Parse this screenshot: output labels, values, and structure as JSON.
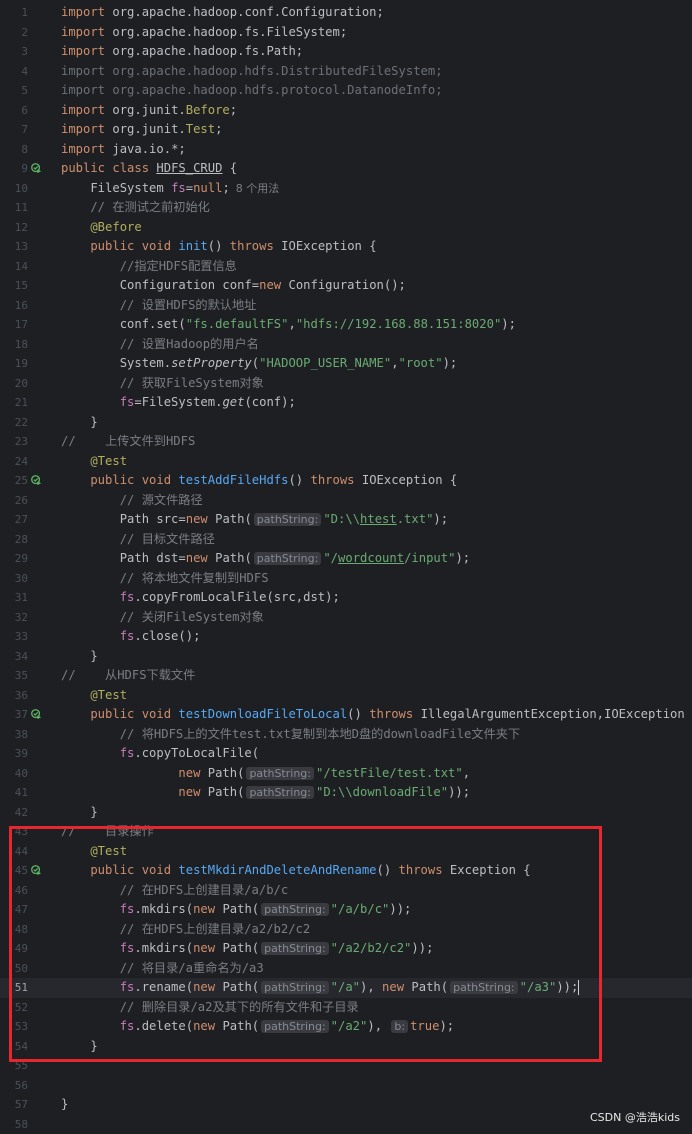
{
  "lines": [
    {
      "n": "1",
      "tokens": [
        [
          "kw",
          "import "
        ],
        [
          "",
          "org.apache.hadoop.conf.Configuration;"
        ]
      ]
    },
    {
      "n": "2",
      "tokens": [
        [
          "kw",
          "import "
        ],
        [
          "",
          "org.apache.hadoop.fs.FileSystem;"
        ]
      ]
    },
    {
      "n": "3",
      "tokens": [
        [
          "kw",
          "import "
        ],
        [
          "",
          "org.apache.hadoop.fs.Path;"
        ]
      ]
    },
    {
      "n": "4",
      "tokens": [
        [
          "dim",
          "import org.apache.hadoop.hdfs.DistributedFileSystem;"
        ]
      ]
    },
    {
      "n": "5",
      "tokens": [
        [
          "dim",
          "import org.apache.hadoop.hdfs.protocol.DatanodeInfo;"
        ]
      ]
    },
    {
      "n": "6",
      "tokens": [
        [
          "kw",
          "import "
        ],
        [
          "",
          "org.junit."
        ],
        [
          "ann",
          "Before"
        ],
        [
          "",
          ";"
        ]
      ]
    },
    {
      "n": "7",
      "tokens": [
        [
          "kw",
          "import "
        ],
        [
          "",
          "org.junit."
        ],
        [
          "ann",
          "Test"
        ],
        [
          "",
          ";"
        ]
      ]
    },
    {
      "n": "8",
      "tokens": [
        [
          "kw",
          "import "
        ],
        [
          "",
          "java.io.*;"
        ]
      ]
    },
    {
      "n": "9",
      "icon": true,
      "tokens": [
        [
          "kw",
          "public class "
        ],
        [
          "cls",
          "HDFS_CRUD"
        ],
        [
          "",
          " {"
        ]
      ]
    },
    {
      "n": "10",
      "tokens": [
        [
          "",
          "    FileSystem "
        ],
        [
          "fld",
          "fs"
        ],
        [
          "",
          "="
        ],
        [
          "kw",
          "null"
        ],
        [
          "",
          ";"
        ],
        [
          "usage",
          "8 个用法"
        ]
      ]
    },
    {
      "n": "11",
      "tokens": [
        [
          "cmt",
          "    // 在测试之前初始化"
        ]
      ]
    },
    {
      "n": "12",
      "tokens": [
        [
          "ann",
          "    @Before"
        ]
      ]
    },
    {
      "n": "13",
      "tokens": [
        [
          "kw",
          "    public void "
        ],
        [
          "fn",
          "init"
        ],
        [
          "",
          "() "
        ],
        [
          "kw",
          "throws "
        ],
        [
          "",
          "IOException {"
        ]
      ]
    },
    {
      "n": "14",
      "tokens": [
        [
          "cmt",
          "        //指定HDFS配置信息"
        ]
      ]
    },
    {
      "n": "15",
      "tokens": [
        [
          "",
          "        Configuration conf="
        ],
        [
          "kw",
          "new "
        ],
        [
          "",
          "Configuration();"
        ]
      ]
    },
    {
      "n": "16",
      "tokens": [
        [
          "cmt",
          "        // 设置HDFS的默认地址"
        ]
      ]
    },
    {
      "n": "17",
      "tokens": [
        [
          "",
          "        conf.set("
        ],
        [
          "str",
          "\"fs.defaultFS\""
        ],
        [
          "",
          ","
        ],
        [
          "str",
          "\"hdfs://192.168.88.151:8020\""
        ],
        [
          "",
          ");"
        ]
      ]
    },
    {
      "n": "18",
      "tokens": [
        [
          "cmt",
          "        // 设置Hadoop的用户名"
        ]
      ]
    },
    {
      "n": "19",
      "tokens": [
        [
          "",
          "        System."
        ],
        [
          "it",
          "setProperty"
        ],
        [
          "",
          "("
        ],
        [
          "str",
          "\"HADOOP_USER_NAME\""
        ],
        [
          "",
          ","
        ],
        [
          "str",
          "\"root\""
        ],
        [
          "",
          ");"
        ]
      ]
    },
    {
      "n": "20",
      "tokens": [
        [
          "cmt",
          "        // 获取FileSystem对象"
        ]
      ]
    },
    {
      "n": "21",
      "tokens": [
        [
          "fld",
          "        fs"
        ],
        [
          "",
          "=FileSystem."
        ],
        [
          "it",
          "get"
        ],
        [
          "",
          "(conf);"
        ]
      ]
    },
    {
      "n": "22",
      "tokens": [
        [
          "",
          "    }"
        ]
      ]
    },
    {
      "n": "23",
      "tokens": [
        [
          "cmt",
          "//    上传文件到HDFS"
        ]
      ]
    },
    {
      "n": "24",
      "tokens": [
        [
          "ann",
          "    @Test"
        ]
      ]
    },
    {
      "n": "25",
      "icon": true,
      "tokens": [
        [
          "kw",
          "    public void "
        ],
        [
          "fn",
          "testAddFileHdfs"
        ],
        [
          "",
          "() "
        ],
        [
          "kw",
          "throws "
        ],
        [
          "",
          "IOException {"
        ]
      ]
    },
    {
      "n": "26",
      "tokens": [
        [
          "cmt",
          "        // 源文件路径"
        ]
      ]
    },
    {
      "n": "27",
      "tokens": [
        [
          "",
          "        Path src="
        ],
        [
          "kw",
          "new "
        ],
        [
          "",
          "Path("
        ],
        [
          "hint",
          "pathString:"
        ],
        [
          "str",
          "\"D:\\\\"
        ],
        [
          "str ul",
          "htest"
        ],
        [
          "str",
          ".txt\""
        ],
        [
          "",
          ");"
        ]
      ]
    },
    {
      "n": "28",
      "tokens": [
        [
          "cmt",
          "        // 目标文件路径"
        ]
      ]
    },
    {
      "n": "29",
      "tokens": [
        [
          "",
          "        Path dst="
        ],
        [
          "kw",
          "new "
        ],
        [
          "",
          "Path("
        ],
        [
          "hint",
          "pathString:"
        ],
        [
          "str",
          "\"/"
        ],
        [
          "str ul",
          "wordcount"
        ],
        [
          "str",
          "/input\""
        ],
        [
          "",
          ");"
        ]
      ]
    },
    {
      "n": "30",
      "tokens": [
        [
          "cmt",
          "        // 将本地文件复制到HDFS"
        ]
      ]
    },
    {
      "n": "31",
      "tokens": [
        [
          "fld",
          "        fs"
        ],
        [
          "",
          ".copyFromLocalFile(src,dst);"
        ]
      ]
    },
    {
      "n": "32",
      "tokens": [
        [
          "cmt",
          "        // 关闭FileSystem对象"
        ]
      ]
    },
    {
      "n": "33",
      "tokens": [
        [
          "fld",
          "        fs"
        ],
        [
          "",
          ".close();"
        ]
      ]
    },
    {
      "n": "34",
      "tokens": [
        [
          "",
          "    }"
        ]
      ]
    },
    {
      "n": "35",
      "tokens": [
        [
          "cmt",
          "//    从HDFS下载文件"
        ]
      ]
    },
    {
      "n": "36",
      "tokens": [
        [
          "ann",
          "    @Test"
        ]
      ]
    },
    {
      "n": "37",
      "icon": true,
      "tokens": [
        [
          "kw",
          "    public void "
        ],
        [
          "fn",
          "testDownloadFileToLocal"
        ],
        [
          "",
          "() "
        ],
        [
          "kw",
          "throws "
        ],
        [
          "",
          "IllegalArgumentException,IOException {"
        ]
      ]
    },
    {
      "n": "38",
      "tokens": [
        [
          "cmt",
          "        // 将HDFS上的文件test.txt复制到本地D盘的downloadFile文件夹下"
        ]
      ]
    },
    {
      "n": "39",
      "tokens": [
        [
          "fld",
          "        fs"
        ],
        [
          "",
          ".copyToLocalFile("
        ]
      ]
    },
    {
      "n": "40",
      "tokens": [
        [
          "kw",
          "                new "
        ],
        [
          "",
          "Path("
        ],
        [
          "hint",
          "pathString:"
        ],
        [
          "str",
          "\"/testFile/test.txt\""
        ],
        [
          "",
          ","
        ]
      ]
    },
    {
      "n": "41",
      "tokens": [
        [
          "kw",
          "                new "
        ],
        [
          "",
          "Path("
        ],
        [
          "hint",
          "pathString:"
        ],
        [
          "str",
          "\"D:\\\\downloadFile\""
        ],
        [
          "",
          "));"
        ]
      ]
    },
    {
      "n": "42",
      "tokens": [
        [
          "",
          "    }"
        ]
      ]
    },
    {
      "n": "43",
      "tokens": [
        [
          "cmt",
          "//    目录操作"
        ]
      ]
    },
    {
      "n": "44",
      "tokens": [
        [
          "ann",
          "    @Test"
        ]
      ]
    },
    {
      "n": "45",
      "icon": true,
      "tokens": [
        [
          "kw",
          "    public void "
        ],
        [
          "fn",
          "testMkdirAndDeleteAndRename"
        ],
        [
          "",
          "() "
        ],
        [
          "kw",
          "throws "
        ],
        [
          "",
          "Exception {"
        ]
      ]
    },
    {
      "n": "46",
      "tokens": [
        [
          "cmt",
          "        // 在HDFS上创建目录/a/b/c"
        ]
      ]
    },
    {
      "n": "47",
      "tokens": [
        [
          "fld",
          "        fs"
        ],
        [
          "",
          ".mkdirs("
        ],
        [
          "kw",
          "new "
        ],
        [
          "",
          "Path("
        ],
        [
          "hint",
          "pathString:"
        ],
        [
          "str",
          "\"/a/b/c\""
        ],
        [
          "",
          "));"
        ]
      ]
    },
    {
      "n": "48",
      "tokens": [
        [
          "cmt",
          "        // 在HDFS上创建目录/a2/b2/c2"
        ]
      ]
    },
    {
      "n": "49",
      "tokens": [
        [
          "fld",
          "        fs"
        ],
        [
          "",
          ".mkdirs("
        ],
        [
          "kw",
          "new "
        ],
        [
          "",
          "Path("
        ],
        [
          "hint",
          "pathString:"
        ],
        [
          "str",
          "\"/a2/b2/c2\""
        ],
        [
          "",
          "));"
        ]
      ]
    },
    {
      "n": "50",
      "tokens": [
        [
          "cmt",
          "        // 将目录/a重命名为/a3"
        ]
      ]
    },
    {
      "n": "51",
      "current": true,
      "tokens": [
        [
          "fld",
          "        fs"
        ],
        [
          "",
          ".rename("
        ],
        [
          "kw",
          "new "
        ],
        [
          "",
          "Path("
        ],
        [
          "hint",
          "pathString:"
        ],
        [
          "str",
          "\"/a\""
        ],
        [
          "",
          "), "
        ],
        [
          "kw",
          "new "
        ],
        [
          "",
          "Path("
        ],
        [
          "hint",
          "pathString:"
        ],
        [
          "str",
          "\"/a3\""
        ],
        [
          "",
          "));"
        ],
        [
          "caret",
          ""
        ]
      ]
    },
    {
      "n": "52",
      "tokens": [
        [
          "cmt",
          "        // 删除目录/a2及其下的所有文件和子目录"
        ]
      ]
    },
    {
      "n": "53",
      "tokens": [
        [
          "fld",
          "        fs"
        ],
        [
          "",
          ".delete("
        ],
        [
          "kw",
          "new "
        ],
        [
          "",
          "Path("
        ],
        [
          "hint",
          "pathString:"
        ],
        [
          "str",
          "\"/a2\""
        ],
        [
          "",
          "), "
        ],
        [
          "hint",
          "b:"
        ],
        [
          "kw",
          "true"
        ],
        [
          "",
          ");"
        ]
      ]
    },
    {
      "n": "54",
      "tokens": [
        [
          "",
          "    }"
        ]
      ]
    },
    {
      "n": "55",
      "tokens": []
    },
    {
      "n": "56",
      "tokens": []
    },
    {
      "n": "57",
      "tokens": [
        [
          "",
          "}"
        ]
      ]
    },
    {
      "n": "58",
      "tokens": []
    }
  ],
  "watermark": "CSDN @浩浩kids",
  "colors": {
    "background": "#1e1f22",
    "keyword": "#cf8e6d",
    "string": "#6aab73",
    "comment": "#7a7e85",
    "annotation": "#b3ae60",
    "method": "#56a8f5",
    "field": "#c77dbb",
    "highlight_box": "#e8262e"
  },
  "icons": {
    "run_gutter": "run-test-icon"
  }
}
